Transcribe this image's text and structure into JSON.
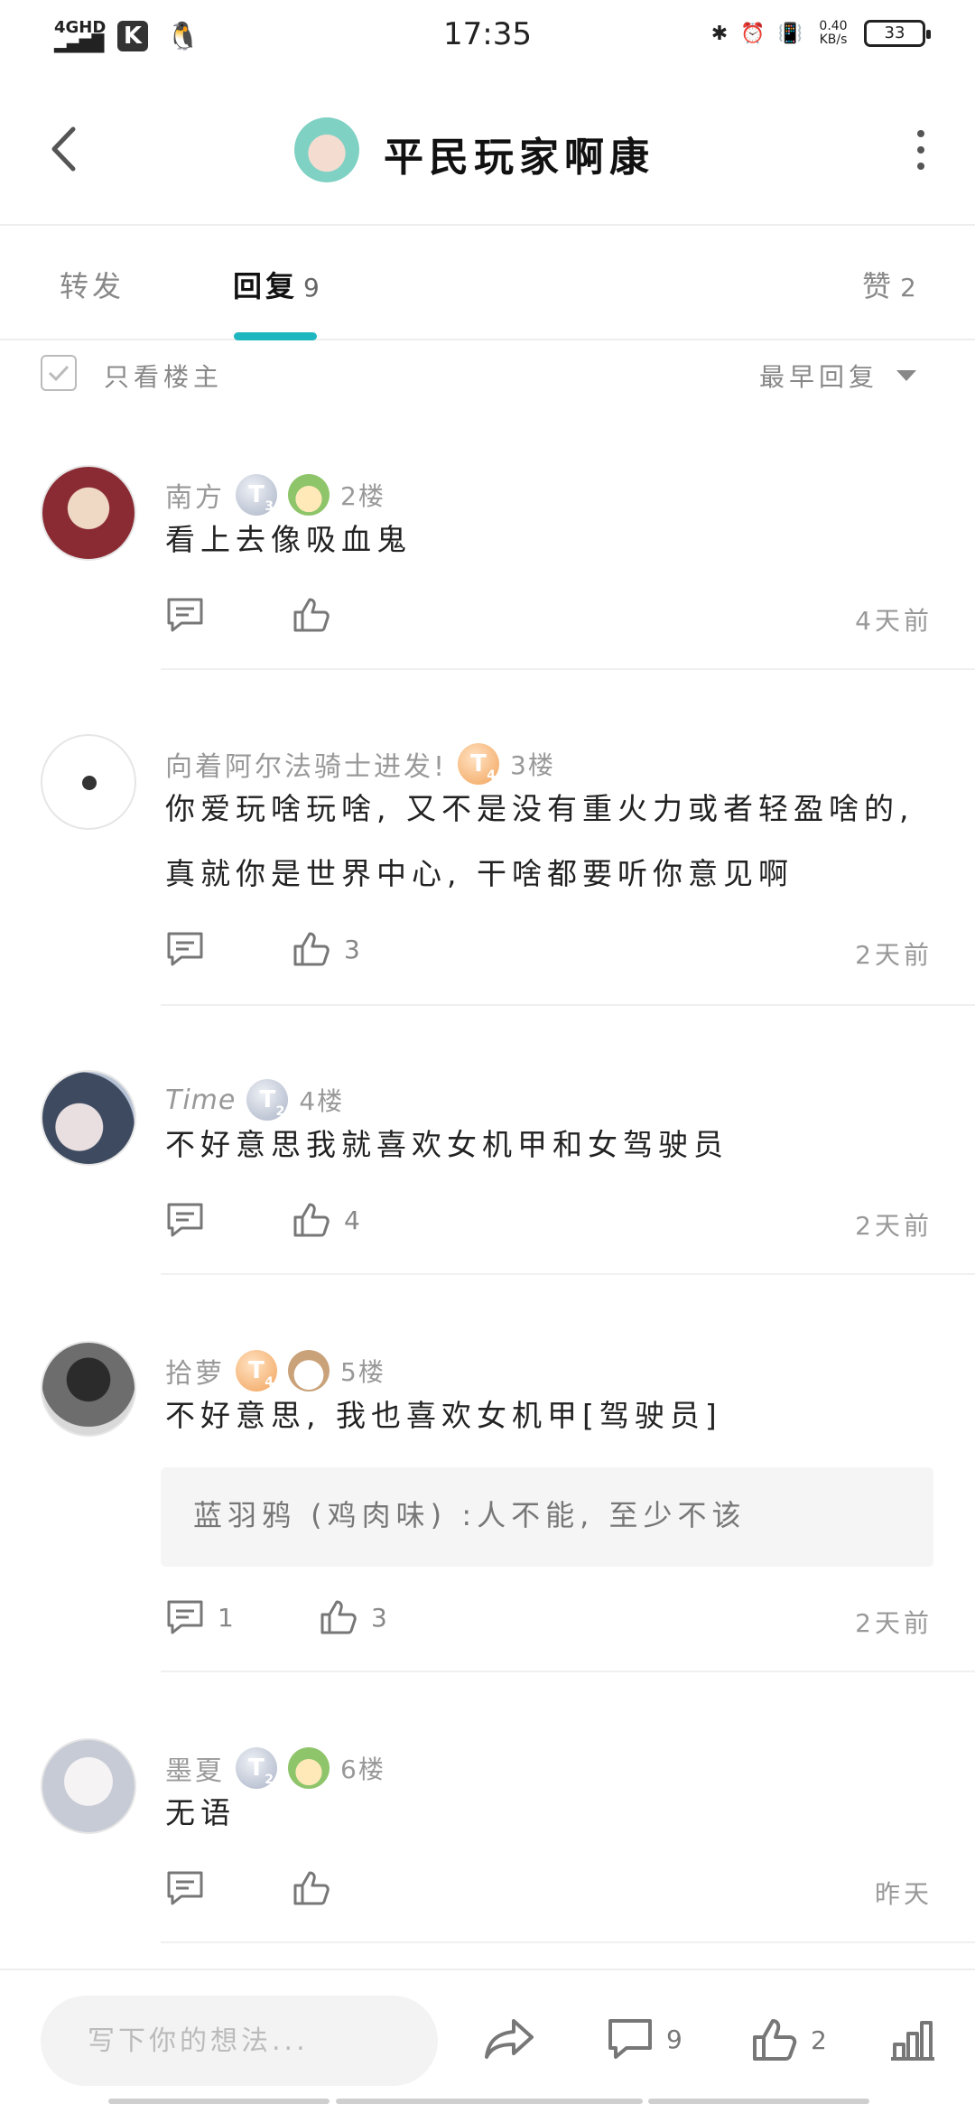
{
  "status_bar": {
    "network": "4GHD",
    "time": "17:35",
    "speed_value": "0.40",
    "speed_unit": "KB/s",
    "battery": "33"
  },
  "header": {
    "title": "平民玩家啊康"
  },
  "tabs": [
    {
      "label": "转发",
      "count": ""
    },
    {
      "label": "回复",
      "count": "9"
    },
    {
      "label": "赞",
      "count": "2"
    }
  ],
  "filter": {
    "only_op_label": "只看楼主",
    "sort_label": "最早回复"
  },
  "replies": [
    {
      "username": "南方",
      "level": "T",
      "level_num": "3",
      "floor": "2楼",
      "content": "看上去像吸血鬼",
      "comment_count": "",
      "like_count": "",
      "time": "4天前"
    },
    {
      "username": "向着阿尔法骑士进发!",
      "level": "T",
      "level_num": "4",
      "floor": "3楼",
      "content": "你爱玩啥玩啥, 又不是没有重火力或者轻盈啥的, 真就你是世界中心, 干啥都要听你意见啊",
      "comment_count": "",
      "like_count": "3",
      "time": "2天前"
    },
    {
      "username": "Time",
      "level": "T",
      "level_num": "2",
      "floor": "4楼",
      "content": "不好意思我就喜欢女机甲和女驾驶员",
      "comment_count": "",
      "like_count": "4",
      "time": "2天前"
    },
    {
      "username": "拾萝",
      "level": "T",
      "level_num": "4",
      "floor": "5楼",
      "content": "不好意思, 我也喜欢女机甲[驾驶员]",
      "quote": "蓝羽鸦 (鸡肉味) :人不能, 至少不该",
      "comment_count": "1",
      "like_count": "3",
      "time": "2天前"
    },
    {
      "username": "墨夏",
      "level": "T",
      "level_num": "2",
      "floor": "6楼",
      "content": "无语",
      "comment_count": "",
      "like_count": "",
      "time": "昨天"
    }
  ],
  "bottom_bar": {
    "input_placeholder": "写下你的想法...",
    "comment_count": "9",
    "like_count": "2"
  },
  "colors": {
    "accent": "#1fb7bf",
    "badge_silver": "#aab3c6",
    "badge_gold": "#f2a35b"
  }
}
